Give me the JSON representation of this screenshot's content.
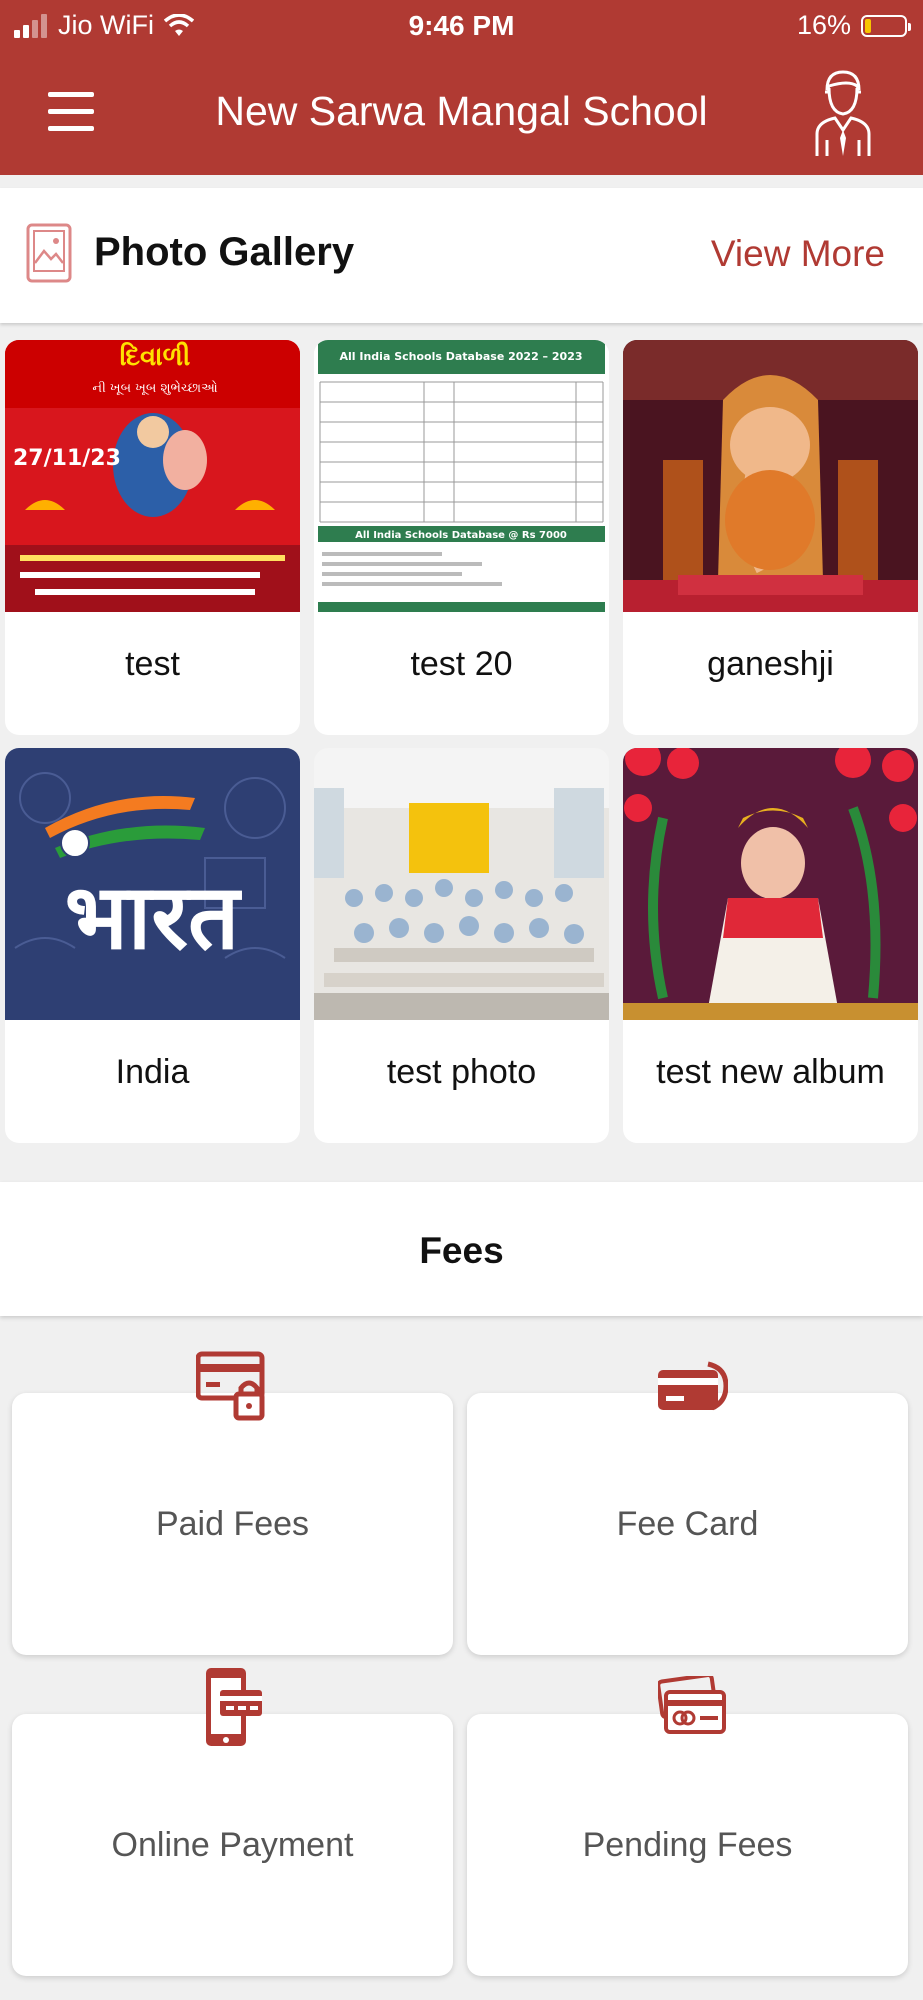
{
  "status_bar": {
    "carrier": "Jio WiFi",
    "time": "9:46 PM",
    "battery": "16%",
    "battery_level": 0.16
  },
  "app_bar": {
    "title": "New Sarwa Mangal School",
    "menu_icon": "hamburger-menu-icon",
    "profile_icon": "teacher-avatar-icon"
  },
  "gallery": {
    "title": "Photo Gallery",
    "view_more": "View More",
    "albums": [
      {
        "name": "test"
      },
      {
        "name": "test 20"
      },
      {
        "name": "ganeshji"
      },
      {
        "name": "India"
      },
      {
        "name": "test photo"
      },
      {
        "name": "test new album"
      }
    ],
    "thumb_text": {
      "diwali_top": "દિવાળી",
      "diwali_greet": "ની ખૂબ ખૂબ શુભેચ્છાઓ",
      "diwali_date": "27/11/23",
      "db_title": "All India Schools Database 2022 – 2023",
      "db_price": "All India Schools Database @ Rs 7000",
      "bharat": "भारत"
    }
  },
  "fees": {
    "title": "Fees",
    "items": [
      {
        "label": "Paid Fees",
        "icon": "secure-card-icon"
      },
      {
        "label": "Fee Card",
        "icon": "payment-card-icon"
      },
      {
        "label": "Online Payment",
        "icon": "mobile-payment-icon"
      },
      {
        "label": "Pending Fees",
        "icon": "card-stack-icon"
      }
    ]
  },
  "colors": {
    "brand": "#b03a33",
    "background": "#f0f0f0"
  }
}
